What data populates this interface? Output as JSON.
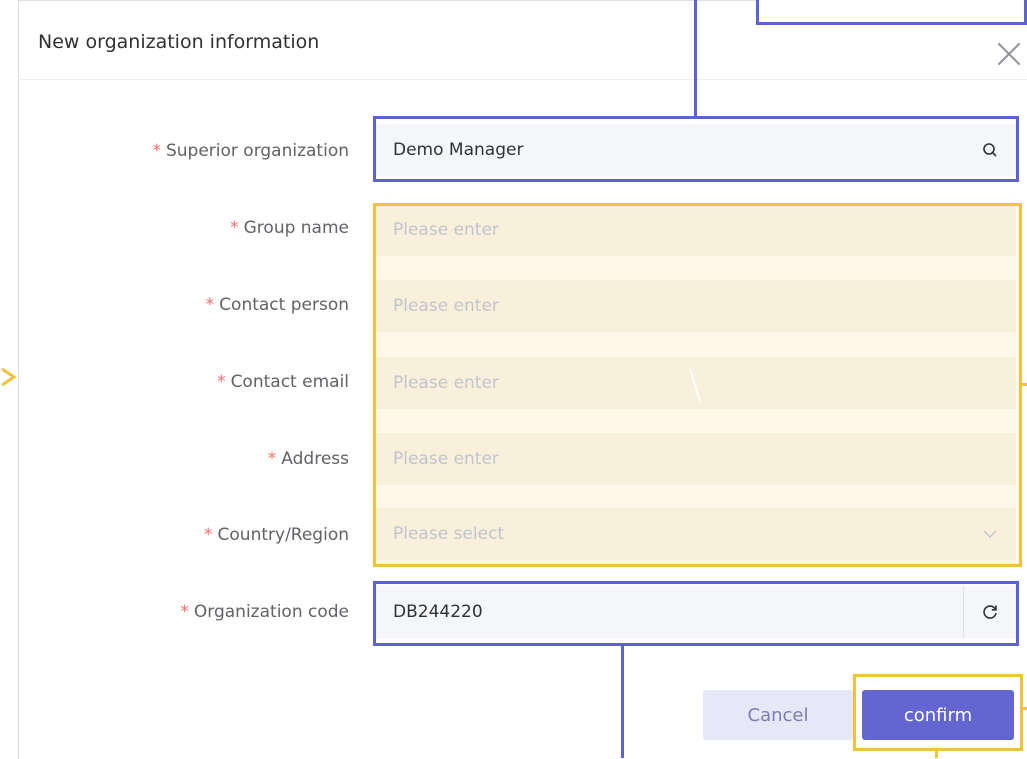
{
  "dialog": {
    "title": "New organization information",
    "close_icon": "close-icon"
  },
  "form": {
    "required_mark": "*",
    "fields": [
      {
        "label": "Superior organization",
        "value": "Demo Manager",
        "placeholder": "",
        "icon": "search-icon"
      },
      {
        "label": "Group name",
        "value": "",
        "placeholder": "Please enter"
      },
      {
        "label": "Contact person",
        "value": "",
        "placeholder": "Please enter"
      },
      {
        "label": "Contact email",
        "value": "",
        "placeholder": "Please enter"
      },
      {
        "label": "Address",
        "value": "",
        "placeholder": "Please enter"
      },
      {
        "label": "Country/Region",
        "value": "",
        "placeholder": "Please select",
        "icon": "chevron-down-icon"
      },
      {
        "label": "Organization code",
        "value": "DB244220",
        "placeholder": "",
        "icon": "refresh-icon"
      }
    ]
  },
  "buttons": {
    "cancel_label": "Cancel",
    "confirm_label": "confirm"
  },
  "colors": {
    "accent": "#6366d1",
    "highlight_blue": "#5b63d4",
    "highlight_yellow": "#f2c23c",
    "required": "#f56c6c"
  }
}
